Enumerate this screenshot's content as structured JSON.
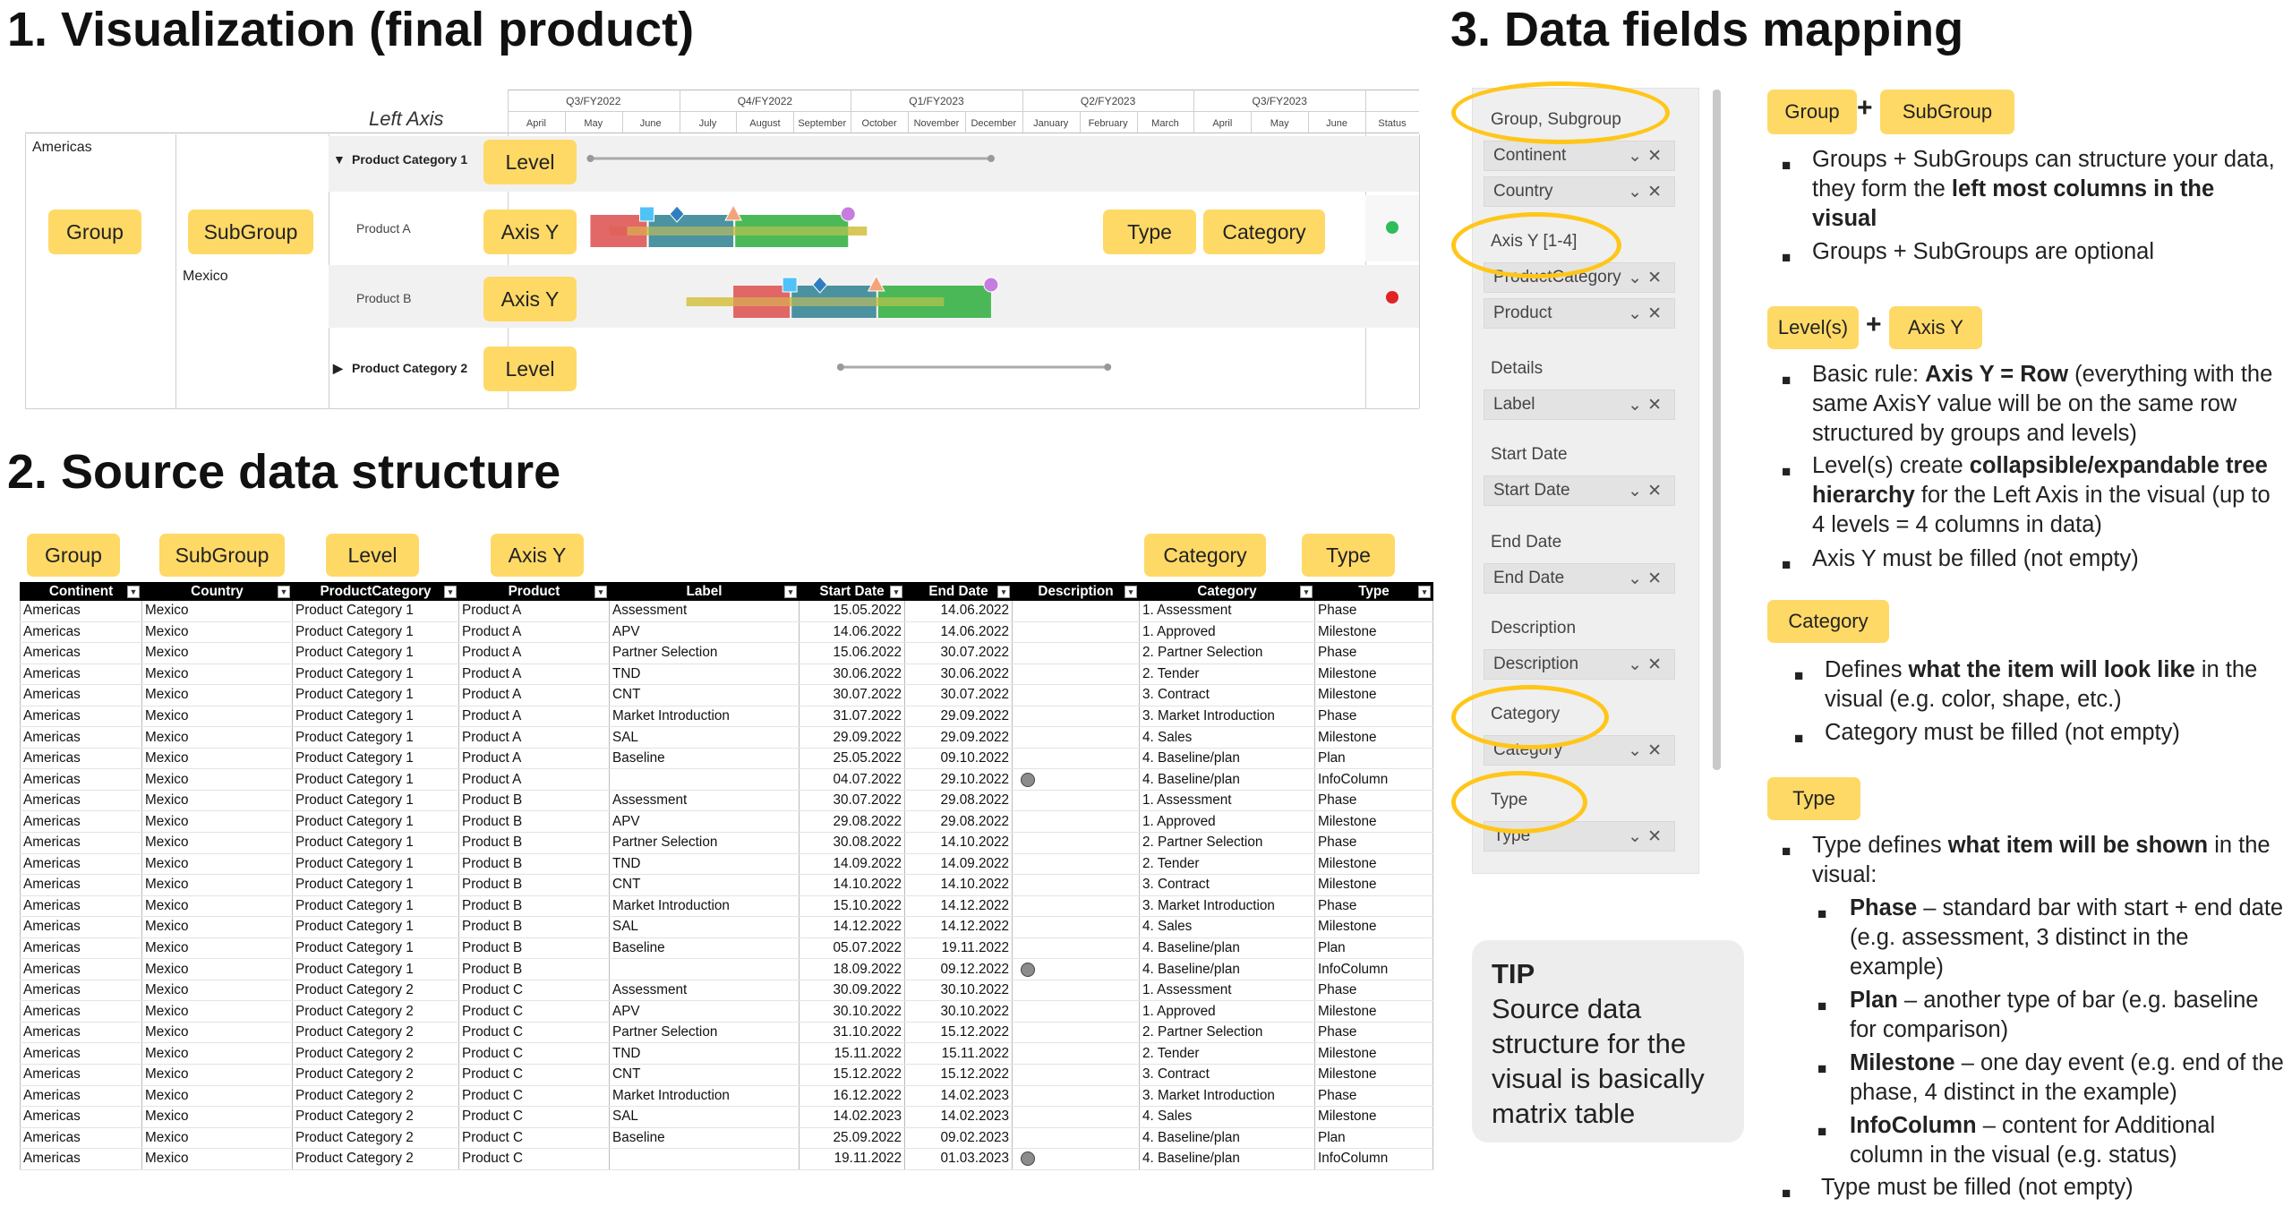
{
  "headings": {
    "h1": "1. Visualization (final product)",
    "h2": "2. Source data structure",
    "h3": "3. Data fields mapping"
  },
  "visual": {
    "left_axis_label": "Left Axis",
    "quarters": [
      "Q3/FY2022",
      "Q4/FY2022",
      "Q1/FY2023",
      "Q2/FY2023",
      "Q3/FY2023"
    ],
    "months": [
      "April",
      "May",
      "June",
      "July",
      "August",
      "September",
      "October",
      "November",
      "December",
      "January",
      "February",
      "March",
      "April",
      "May",
      "June"
    ],
    "status_header": "Status",
    "group_value": "Americas",
    "subgroup_value": "Mexico",
    "rows": [
      {
        "label": "Product Category 1",
        "kind": "level",
        "expanded": true
      },
      {
        "label": "Product A",
        "kind": "item",
        "status": "#2ebd59"
      },
      {
        "label": "Product B",
        "kind": "item",
        "status": "#e02424"
      },
      {
        "label": "Product Category 2",
        "kind": "level",
        "expanded": false
      }
    ],
    "pills": {
      "group": "Group",
      "subgroup": "SubGroup",
      "level": "Level",
      "axis_y": "Axis Y",
      "type": "Type",
      "category": "Category"
    },
    "colors": {
      "phase_assessment": "#e05a5a",
      "phase_partner": "#3c8a99",
      "phase_market": "#3cb34a",
      "plan": "#d9c85a",
      "milestone_apv": "#4fc3f7",
      "milestone_tnd": "#2f7fc0",
      "milestone_cnt": "#f4a37a",
      "milestone_sal": "#c77de0"
    }
  },
  "source_pills": [
    "Group",
    "SubGroup",
    "Level",
    "Axis Y",
    "Category",
    "Type"
  ],
  "table": {
    "headers": [
      "Continent",
      "Country",
      "ProductCategory",
      "Product",
      "Label",
      "Start Date",
      "End Date",
      "Description",
      "Category",
      "Type"
    ],
    "rows": [
      [
        "Americas",
        "Mexico",
        "Product Category 1",
        "Product A",
        "Assessment",
        "15.05.2022",
        "14.06.2022",
        "",
        "1. Assessment",
        "Phase"
      ],
      [
        "Americas",
        "Mexico",
        "Product Category 1",
        "Product A",
        "APV",
        "14.06.2022",
        "14.06.2022",
        "",
        "1. Approved",
        "Milestone"
      ],
      [
        "Americas",
        "Mexico",
        "Product Category 1",
        "Product A",
        "Partner Selection",
        "15.06.2022",
        "30.07.2022",
        "",
        "2. Partner Selection",
        "Phase"
      ],
      [
        "Americas",
        "Mexico",
        "Product Category 1",
        "Product A",
        "TND",
        "30.06.2022",
        "30.06.2022",
        "",
        "2. Tender",
        "Milestone"
      ],
      [
        "Americas",
        "Mexico",
        "Product Category 1",
        "Product A",
        "CNT",
        "30.07.2022",
        "30.07.2022",
        "",
        "3. Contract",
        "Milestone"
      ],
      [
        "Americas",
        "Mexico",
        "Product Category 1",
        "Product A",
        "Market Introduction",
        "31.07.2022",
        "29.09.2022",
        "",
        "3. Market Introduction",
        "Phase"
      ],
      [
        "Americas",
        "Mexico",
        "Product Category 1",
        "Product A",
        "SAL",
        "29.09.2022",
        "29.09.2022",
        "",
        "4. Sales",
        "Milestone"
      ],
      [
        "Americas",
        "Mexico",
        "Product Category 1",
        "Product A",
        "Baseline",
        "25.05.2022",
        "09.10.2022",
        "",
        "4. Baseline/plan",
        "Plan"
      ],
      [
        "Americas",
        "Mexico",
        "Product Category 1",
        "Product A",
        "",
        "04.07.2022",
        "29.10.2022",
        "dot",
        "4. Baseline/plan",
        "InfoColumn"
      ],
      [
        "Americas",
        "Mexico",
        "Product Category 1",
        "Product B",
        "Assessment",
        "30.07.2022",
        "29.08.2022",
        "",
        "1. Assessment",
        "Phase"
      ],
      [
        "Americas",
        "Mexico",
        "Product Category 1",
        "Product B",
        "APV",
        "29.08.2022",
        "29.08.2022",
        "",
        "1. Approved",
        "Milestone"
      ],
      [
        "Americas",
        "Mexico",
        "Product Category 1",
        "Product B",
        "Partner Selection",
        "30.08.2022",
        "14.10.2022",
        "",
        "2. Partner Selection",
        "Phase"
      ],
      [
        "Americas",
        "Mexico",
        "Product Category 1",
        "Product B",
        "TND",
        "14.09.2022",
        "14.09.2022",
        "",
        "2. Tender",
        "Milestone"
      ],
      [
        "Americas",
        "Mexico",
        "Product Category 1",
        "Product B",
        "CNT",
        "14.10.2022",
        "14.10.2022",
        "",
        "3. Contract",
        "Milestone"
      ],
      [
        "Americas",
        "Mexico",
        "Product Category 1",
        "Product B",
        "Market Introduction",
        "15.10.2022",
        "14.12.2022",
        "",
        "3. Market Introduction",
        "Phase"
      ],
      [
        "Americas",
        "Mexico",
        "Product Category 1",
        "Product B",
        "SAL",
        "14.12.2022",
        "14.12.2022",
        "",
        "4. Sales",
        "Milestone"
      ],
      [
        "Americas",
        "Mexico",
        "Product Category 1",
        "Product B",
        "Baseline",
        "05.07.2022",
        "19.11.2022",
        "",
        "4. Baseline/plan",
        "Plan"
      ],
      [
        "Americas",
        "Mexico",
        "Product Category 1",
        "Product B",
        "",
        "18.09.2022",
        "09.12.2022",
        "dot",
        "4. Baseline/plan",
        "InfoColumn"
      ],
      [
        "Americas",
        "Mexico",
        "Product Category 2",
        "Product C",
        "Assessment",
        "30.09.2022",
        "30.10.2022",
        "",
        "1. Assessment",
        "Phase"
      ],
      [
        "Americas",
        "Mexico",
        "Product Category 2",
        "Product C",
        "APV",
        "30.10.2022",
        "30.10.2022",
        "",
        "1. Approved",
        "Milestone"
      ],
      [
        "Americas",
        "Mexico",
        "Product Category 2",
        "Product C",
        "Partner Selection",
        "31.10.2022",
        "15.12.2022",
        "",
        "2. Partner Selection",
        "Phase"
      ],
      [
        "Americas",
        "Mexico",
        "Product Category 2",
        "Product C",
        "TND",
        "15.11.2022",
        "15.11.2022",
        "",
        "2. Tender",
        "Milestone"
      ],
      [
        "Americas",
        "Mexico",
        "Product Category 2",
        "Product C",
        "CNT",
        "15.12.2022",
        "15.12.2022",
        "",
        "3. Contract",
        "Milestone"
      ],
      [
        "Americas",
        "Mexico",
        "Product Category 2",
        "Product C",
        "Market Introduction",
        "16.12.2022",
        "14.02.2023",
        "",
        "3. Market Introduction",
        "Phase"
      ],
      [
        "Americas",
        "Mexico",
        "Product Category 2",
        "Product C",
        "SAL",
        "14.02.2023",
        "14.02.2023",
        "",
        "4. Sales",
        "Milestone"
      ],
      [
        "Americas",
        "Mexico",
        "Product Category 2",
        "Product C",
        "Baseline",
        "25.09.2022",
        "09.02.2023",
        "",
        "4. Baseline/plan",
        "Plan"
      ],
      [
        "Americas",
        "Mexico",
        "Product Category 2",
        "Product C",
        "",
        "19.11.2022",
        "01.03.2023",
        "dot",
        "4. Baseline/plan",
        "InfoColumn"
      ]
    ]
  },
  "fields": {
    "sections": [
      {
        "title": "Group, Subgroup",
        "items": [
          "Continent",
          "Country"
        ]
      },
      {
        "title": "Axis Y [1-4]",
        "items": [
          "ProductCategory",
          "Product"
        ]
      },
      {
        "title": "Details",
        "items": [
          "Label"
        ]
      },
      {
        "title": "Start Date",
        "items": [
          "Start Date"
        ]
      },
      {
        "title": "End Date",
        "items": [
          "End Date"
        ]
      },
      {
        "title": "Description",
        "items": [
          "Description"
        ]
      },
      {
        "title": "Category",
        "items": [
          "Category"
        ]
      },
      {
        "title": "Type",
        "items": [
          "Type"
        ]
      }
    ]
  },
  "tip": {
    "title": "TIP",
    "text": "Source data structure for the visual is basically matrix table"
  },
  "notes": {
    "pill_group": "Group",
    "pill_subgroup": "SubGroup",
    "plus": "+",
    "g1a": "Groups + SubGroups can structure your data, they form the ",
    "g1b": "left most columns in the visual",
    "g2": "Groups + SubGroups are optional",
    "pill_levels": "Level(s)",
    "pill_axisy": "Axis Y",
    "l1a": "Basic rule: ",
    "l1b": "Axis Y = Row",
    "l1c": " (everything with the same AxisY value will be on the same row structured by groups and levels)",
    "l2a": "Level(s) create ",
    "l2b": "collapsible/expandable tree hierarchy",
    "l2c": " for the Left Axis in the visual (up to 4 levels = 4 columns in data)",
    "l3": "Axis Y must be filled (not empty)",
    "pill_category": "Category",
    "c1a": "Defines ",
    "c1b": "what the item will look like",
    "c1c": " in the visual (e.g. color, shape, etc.)",
    "c2": "Category must be filled (not empty)",
    "pill_type": "Type",
    "t1a": "Type defines ",
    "t1b": "what item will be shown",
    "t1c": " in the visual:",
    "t2a": "Phase",
    "t2b": " – standard bar with start + end date (e.g. assessment, 3 distinct in the example)",
    "t3a": "Plan",
    "t3b": " – another type of bar (e.g. baseline for comparison)",
    "t4a": "Milestone",
    "t4b": " – one day event (e.g. end of the phase, 4 distinct in the example)",
    "t5a": "InfoColumn",
    "t5b": " – content for Additional column in the visual (e.g. status)",
    "t6": "Type must be filled (not empty)"
  }
}
